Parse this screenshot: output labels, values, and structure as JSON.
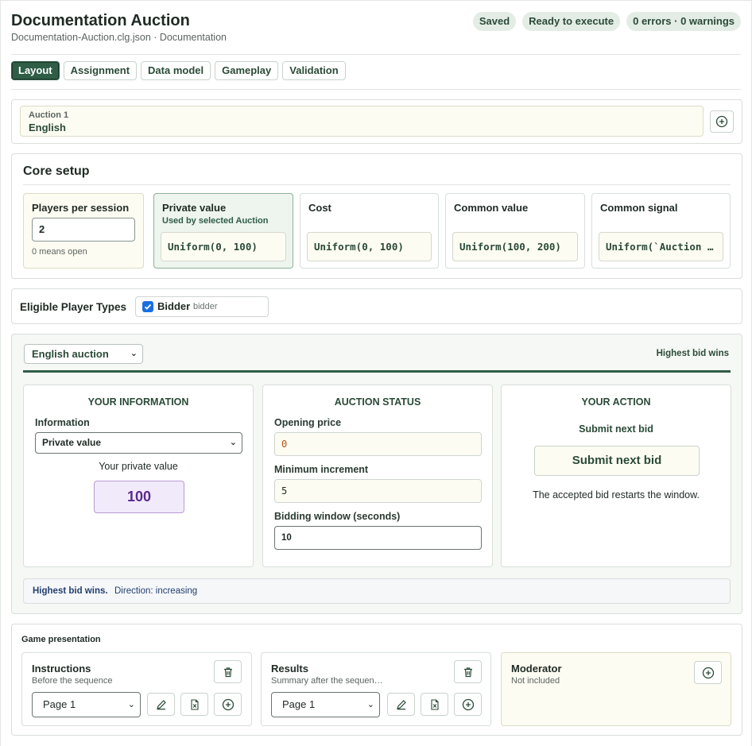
{
  "header": {
    "title": "Documentation Auction",
    "subtitle": "Documentation-Auction.clg.json · Documentation",
    "badges": [
      "Saved",
      "Ready to execute",
      "0 errors · 0 warnings"
    ]
  },
  "tabs": [
    {
      "label": "Layout",
      "active": true
    },
    {
      "label": "Assignment",
      "active": false
    },
    {
      "label": "Data model",
      "active": false
    },
    {
      "label": "Gameplay",
      "active": false
    },
    {
      "label": "Validation",
      "active": false
    }
  ],
  "auction": {
    "label": "Auction 1",
    "value": "English",
    "add_icon": "plus-circle-icon"
  },
  "core_setup": {
    "title": "Core setup",
    "players": {
      "title": "Players per session",
      "value": "2",
      "hint": "0 means open"
    },
    "private_value": {
      "title": "Private value",
      "subtitle": "Used by selected Auction",
      "value": "Uniform(0, 100)"
    },
    "cost": {
      "title": "Cost",
      "value": "Uniform(0, 100)"
    },
    "common_value": {
      "title": "Common value",
      "value": "Uniform(100, 200)"
    },
    "common_signal": {
      "title": "Common signal",
      "value": "Uniform(`Auction c…"
    }
  },
  "eligible": {
    "label": "Eligible Player Types",
    "type_name": "Bidder",
    "type_id": "bidder",
    "checked": true
  },
  "gameplay": {
    "mechanism": "English auction",
    "win_rule": "Highest bid wins",
    "info_panel": {
      "heading": "YOUR INFORMATION",
      "info_label": "Information",
      "info_selected": "Private value",
      "pv_label": "Your private value",
      "pv_value": "100"
    },
    "status_panel": {
      "heading": "AUCTION STATUS",
      "opening_label": "Opening price",
      "opening_value": "0",
      "increment_label": "Minimum increment",
      "increment_value": "5",
      "window_label": "Bidding window (seconds)",
      "window_value": "10"
    },
    "action_panel": {
      "heading": "YOUR ACTION",
      "subheading": "Submit next bid",
      "button": "Submit next bid",
      "note": "The accepted bid restarts the window."
    },
    "footer": {
      "bold": "Highest bid wins.",
      "direction": "Direction: increasing"
    }
  },
  "presentation": {
    "title": "Game presentation",
    "instructions": {
      "title": "Instructions",
      "subtitle": "Before the sequence",
      "page": "Page 1"
    },
    "results": {
      "title": "Results",
      "subtitle": "Summary after the sequen…",
      "page": "Page 1"
    },
    "moderator": {
      "title": "Moderator",
      "subtitle": "Not included"
    }
  },
  "colors": {
    "accent": "#2f5d46",
    "cream": "#fdfcf2",
    "selected_bg": "#eef5ee",
    "purple": "#5b2a8a",
    "checkbox": "#1a6fe0"
  }
}
